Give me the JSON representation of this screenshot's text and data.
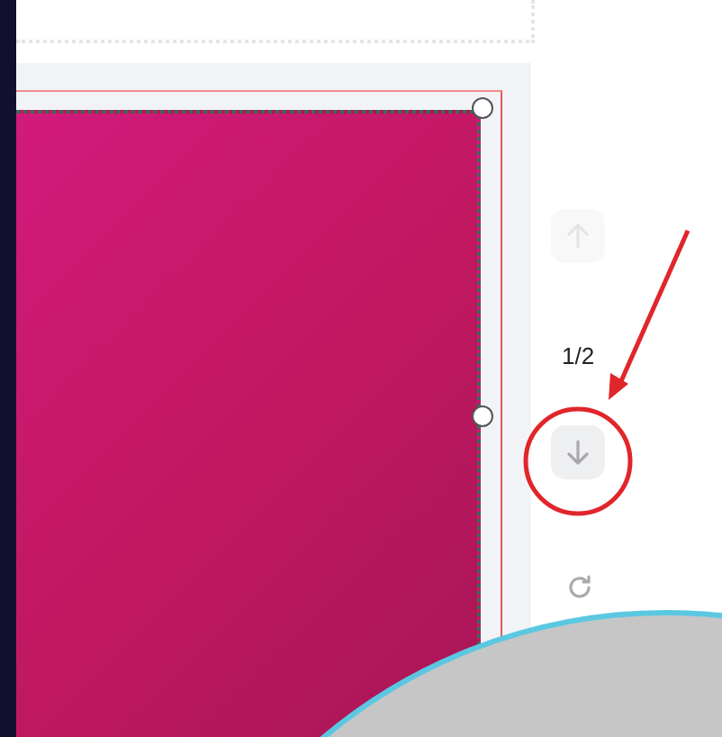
{
  "canvas": {
    "selected": true
  },
  "page_nav": {
    "up": {
      "disabled": true
    },
    "counter": "1/2",
    "down": {
      "disabled": false
    }
  }
}
